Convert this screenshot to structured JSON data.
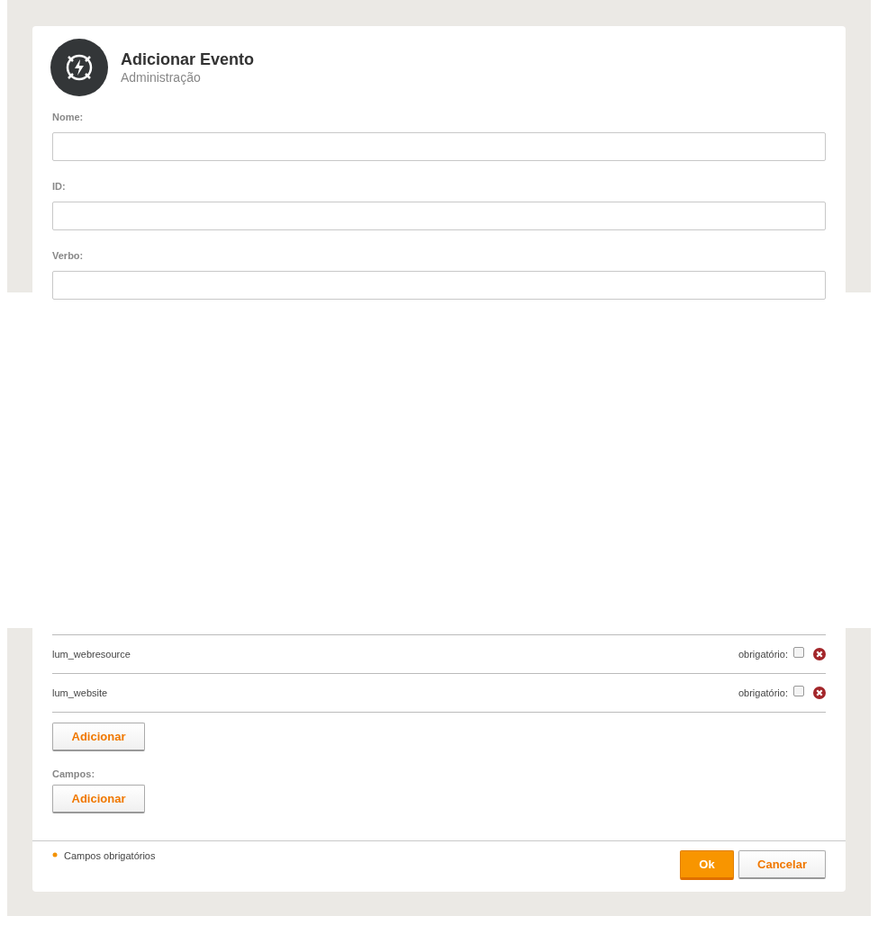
{
  "header": {
    "title": "Adicionar Evento",
    "subtitle": "Administração"
  },
  "fields": [
    {
      "label": "Nome:"
    },
    {
      "label": "ID:"
    },
    {
      "label": "Verbo:"
    }
  ],
  "resources": [
    {
      "name": "lum_webresource",
      "required_label": "obrigatório:",
      "checked": false
    },
    {
      "name": "lum_website",
      "required_label": "obrigatório:",
      "checked": false
    }
  ],
  "resources_add_button": "Adicionar",
  "campos": {
    "label": "Campos:",
    "add_button": "Adicionar"
  },
  "footer": {
    "note": "Campos obrigatórios",
    "ok_button": "Ok",
    "cancel_button": "Cancelar"
  }
}
